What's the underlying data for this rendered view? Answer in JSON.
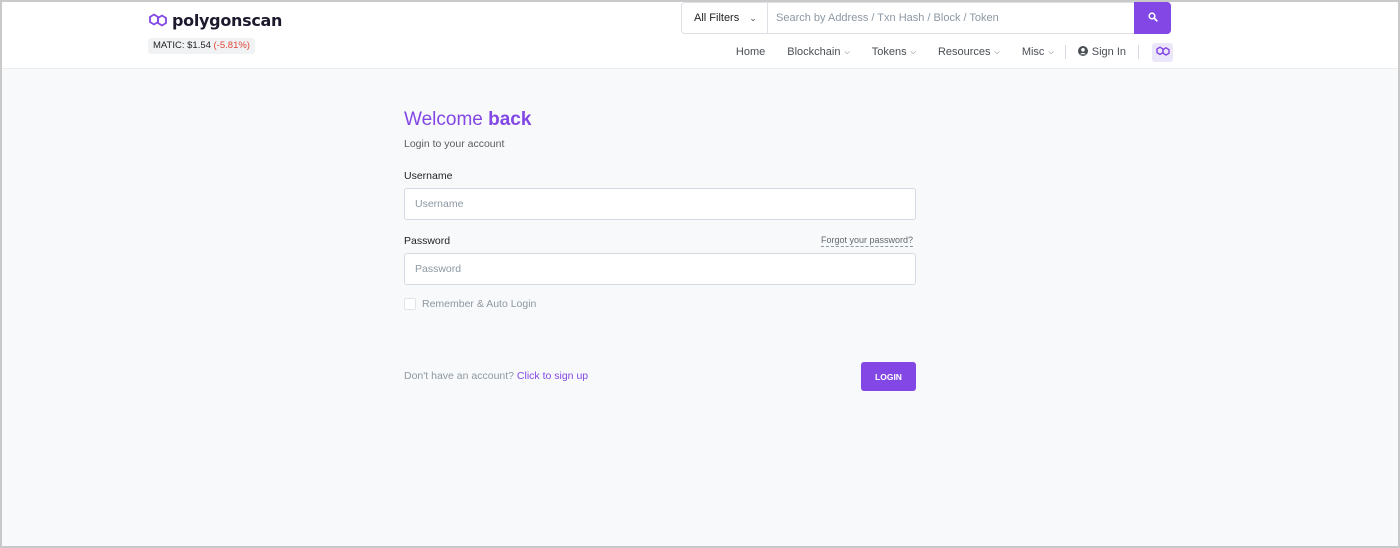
{
  "brand": {
    "name": "polygonscan",
    "color": "#8247e5"
  },
  "price": {
    "label": "MATIC: $1.54",
    "change": "(-5.81%)"
  },
  "search": {
    "filter_label": "All Filters",
    "placeholder": "Search by Address / Txn Hash / Block / Token",
    "button_icon": "search-icon"
  },
  "nav": {
    "home": "Home",
    "blockchain": "Blockchain",
    "tokens": "Tokens",
    "resources": "Resources",
    "misc": "Misc",
    "sign_in": "Sign In"
  },
  "login": {
    "title_prefix": "Welcome ",
    "title_bold": "back",
    "subtitle": "Login to your account",
    "username_label": "Username",
    "username_placeholder": "Username",
    "password_label": "Password",
    "password_placeholder": "Password",
    "forgot": "Forgot your password?",
    "remember": "Remember & Auto Login",
    "no_account": "Don't have an account? ",
    "signup_link": "Click to sign up",
    "login_button": "LOGIN"
  }
}
